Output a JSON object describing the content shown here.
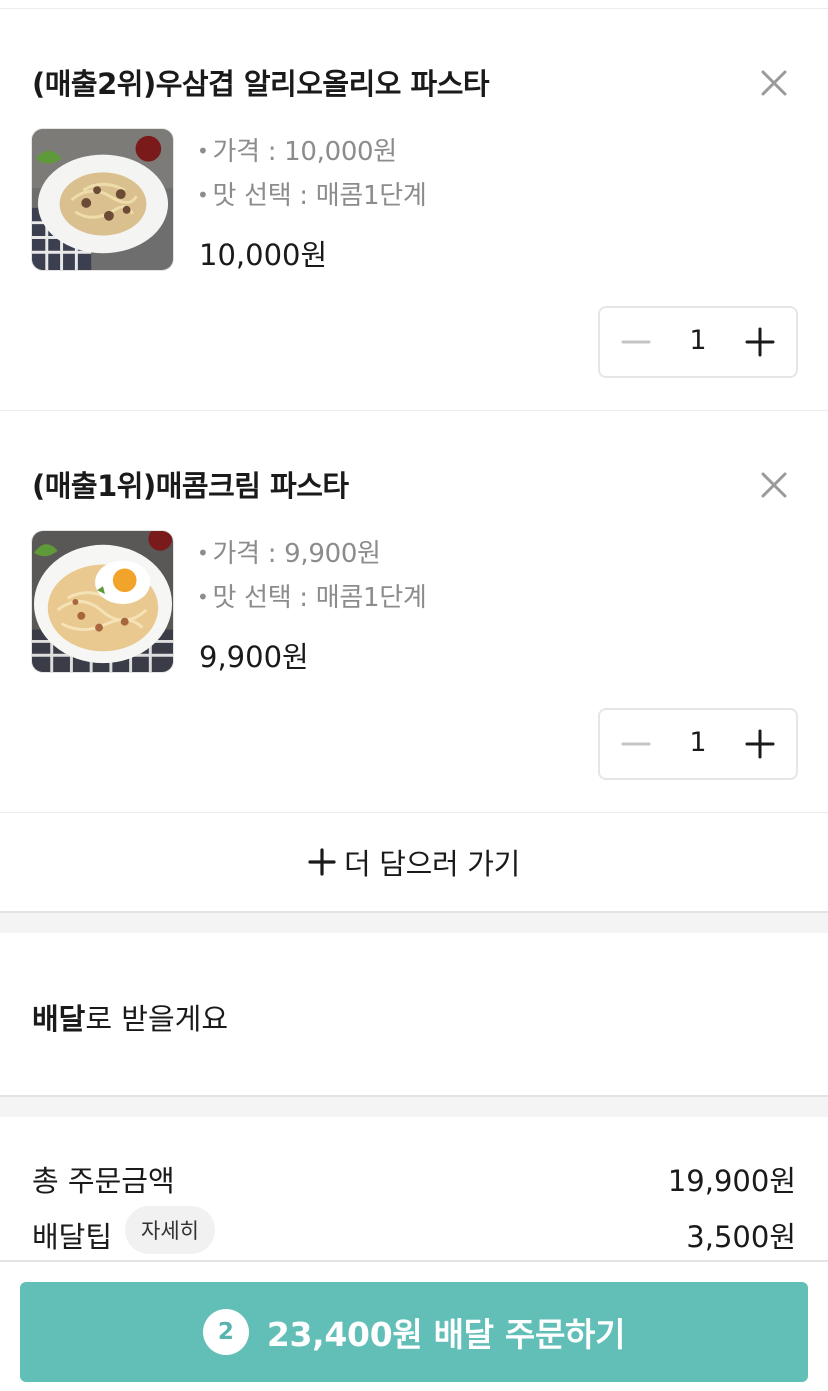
{
  "cart": {
    "items": [
      {
        "name": "(매출2위)우삼겹 알리오올리오 파스타",
        "price_option": "가격 : 10,000원",
        "taste_option": "맛 선택 : 매콤1단계",
        "total": "10,000원",
        "quantity": "1",
        "image_icon": "pasta-aglio-olio-image"
      },
      {
        "name": "(매출1위)매콤크림 파스타",
        "price_option": "가격 : 9,900원",
        "taste_option": "맛 선택 : 매콤1단계",
        "total": "9,900원",
        "quantity": "1",
        "image_icon": "cream-pasta-image"
      }
    ],
    "add_more_label": "더 담으러 가기"
  },
  "delivery": {
    "method_bold": "배달",
    "method_rest": "로 받을게요"
  },
  "summary": {
    "total_label": "총 주문금액",
    "total_value": "19,900원",
    "tip_label": "배달팁",
    "tip_detail_label": "자세히",
    "tip_value": "3,500원"
  },
  "order_button": {
    "count": "2",
    "label": "23,400원 배달 주문하기"
  },
  "colors": {
    "accent": "#62bfb8",
    "muted_text": "#8c8c8c",
    "divider": "#ececec"
  }
}
